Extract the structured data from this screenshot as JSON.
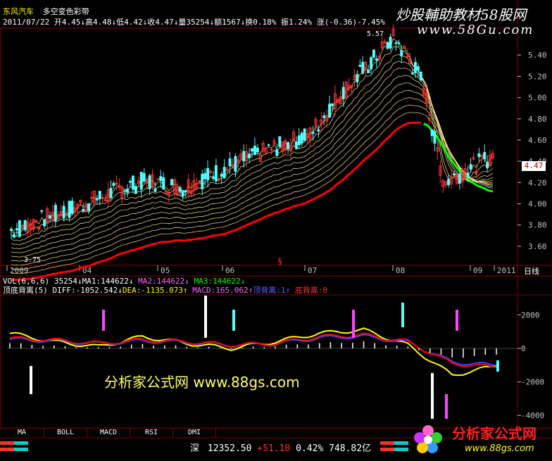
{
  "header": {
    "stock_name": "东风汽车",
    "indicator_name": "多空变色彩带",
    "date": "2011/07/22",
    "open": "开4.45↓",
    "high": "高4.48↓",
    "low": "低4.42↓",
    "close": "收4.47↓",
    "volume": "量35254↓",
    "amount": "额1567↓",
    "turnover": "换0.18%",
    "amplitude": "振1.24%",
    "change": "涨(-0.36)-7.45%"
  },
  "watermark": {
    "top_title": "炒股輔助教材58股网",
    "top_url": "www.58Gu.com",
    "mid_text": "分析家公式网 www.88gs.com",
    "bottom_title": "分析家公式网",
    "bottom_url": "www.88gs.com"
  },
  "price_panel": {
    "current_price_tag": "4.47",
    "low_marker": "3.75",
    "high_marker": "5.57",
    "x_labels": [
      "2009",
      "04",
      "05",
      "06",
      "07",
      "08",
      "09",
      "2011"
    ],
    "period": "日线"
  },
  "volume_header": {
    "vol": "VOL(6,6,6) 35254↓",
    "ma1": "MA1:144622↓",
    "ma2": "MA2:144622↓",
    "ma3": "MA3:144622↓"
  },
  "macd_header": {
    "name": "顶底背离(5)",
    "diff": "DIFF:-1052.542↓",
    "dea": "DEA:-1135.073↑",
    "macd": "MACD:165.062↑",
    "top_div": "顶背离:1↑",
    "bottom_div": "底背离:0"
  },
  "tabs": [
    "MA",
    "BOLL",
    "MACD",
    "RSI",
    "DMI"
  ],
  "status_bar": {
    "market": "深",
    "index": "12352.50",
    "change": "+51.10",
    "pct": "0.42%",
    "turnover": "748.82亿"
  },
  "colors": {
    "up": "#ff3232",
    "down": "#54fcfc",
    "bull_line": "#ff0000",
    "bear_line": "#00ff00",
    "diff": "#ffff00",
    "dea": "#ff0000",
    "ma_blue": "#4040ff",
    "grid": "#800000"
  },
  "chart_data": [
    {
      "type": "line",
      "name": "price",
      "x": [
        "2009",
        "04",
        "05",
        "06",
        "07",
        "08",
        "09",
        "2011"
      ],
      "y_ticks": [
        3.6,
        3.8,
        4.0,
        4.2,
        4.4,
        4.6,
        4.8,
        5.0,
        5.2,
        5.4
      ],
      "ylim": [
        3.5,
        5.6
      ],
      "series": [
        {
          "name": "close",
          "values": [
            3.75,
            3.95,
            4.22,
            4.15,
            4.45,
            4.65,
            5.0,
            5.57,
            5.15,
            4.2,
            4.47
          ]
        }
      ]
    },
    {
      "type": "bar",
      "name": "macd",
      "y_ticks": [
        2000,
        0,
        -2000,
        -4000
      ],
      "ylim": [
        -4200,
        3200
      ],
      "series": [
        {
          "name": "DIFF",
          "values": [
            900,
            400,
            100,
            700,
            300,
            0,
            400,
            900,
            1100,
            200,
            -1600,
            -1052
          ]
        },
        {
          "name": "DEA",
          "values": [
            600,
            500,
            300,
            500,
            400,
            200,
            300,
            700,
            800,
            400,
            -900,
            -1135
          ]
        }
      ]
    }
  ]
}
